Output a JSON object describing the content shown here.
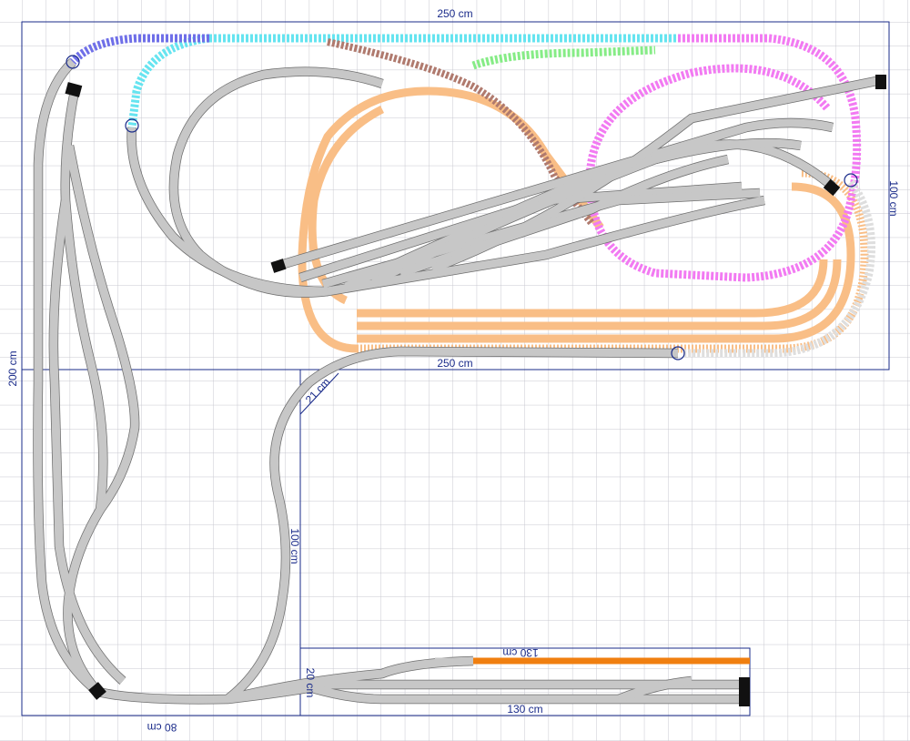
{
  "title": "",
  "colors": {
    "background": "#ffffff",
    "grid": "#c8c8d0",
    "outline": "#1a2b8a",
    "track_grey": "#c7c7c7",
    "track_edge": "#6e6e6e",
    "blue": "#6f6fe8",
    "cyan": "#66e4f0",
    "brown": "#b07a6e",
    "green": "#86ec86",
    "magenta": "#f27af2",
    "orange": "#f9be86",
    "light_grey": "#dedede",
    "deep_orange": "#f07f10",
    "buffer": "#111111"
  },
  "dimensions": {
    "top_width": "250 cm",
    "mid_width": "250 cm",
    "right_height": "100 cm",
    "left_height": "200 cm",
    "diagonal": "21 cm",
    "inner_height": "100 cm",
    "bottom_left_width": "80 cm",
    "staging_height": "20 cm",
    "staging_top_length": "130 cm",
    "staging_bottom_length": "130 cm"
  },
  "legend_icons": [
    "buffer-stop-icon",
    "track-connector-icon"
  ]
}
